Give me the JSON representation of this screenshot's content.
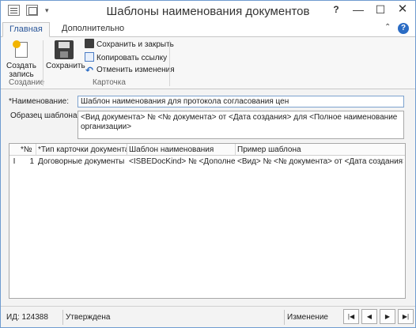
{
  "window": {
    "title": "Шаблоны наименования документов",
    "help_label": "?",
    "minimize_label": "—",
    "maximize_label": "☐",
    "close_label": "✕"
  },
  "ribbon": {
    "tabs": [
      {
        "label": "Главная",
        "active": true
      },
      {
        "label": "Дополнительно",
        "active": false
      }
    ],
    "collapse_label": "⌃",
    "help_label": "?",
    "groups": [
      {
        "label": "Создание",
        "buttons": [
          {
            "label_line1": "Создать",
            "label_line2": "запись",
            "icon": "new-record-icon"
          }
        ]
      },
      {
        "label": "Карточка",
        "buttons": [
          {
            "label": "Сохранить",
            "icon": "save-icon"
          }
        ],
        "small_buttons": [
          {
            "label": "Сохранить и закрыть",
            "icon": "save-close-icon"
          },
          {
            "label": "Копировать ссылку",
            "icon": "copy-link-icon"
          },
          {
            "label": "Отменить изменения",
            "icon": "undo-icon"
          }
        ]
      }
    ]
  },
  "form": {
    "name_label": "*Наименование:",
    "name_value": "Шаблон наименования для протокола согласования цен",
    "sample_label": "Образец шаблона:",
    "sample_value": "<Вид документа> № <№ документа> от <Дата создания> для <Полное наименование организации>"
  },
  "grid": {
    "columns": [
      "*№",
      "*Тип карточки документа",
      "Шаблон наименования",
      "Пример шаблона"
    ],
    "rows": [
      {
        "marker": "I",
        "num": "1",
        "doc_type": "Договорные документы",
        "template": "<ISBEDocKind> № <Дополнен…",
        "example": "<Вид> № <№ документа> от <Дата создания> д…"
      }
    ]
  },
  "status": {
    "id": "ИД: 124388",
    "state": "Утверждена",
    "mode": "Изменение",
    "nav": [
      "|◀",
      "◀",
      "▶",
      "▶|"
    ]
  }
}
